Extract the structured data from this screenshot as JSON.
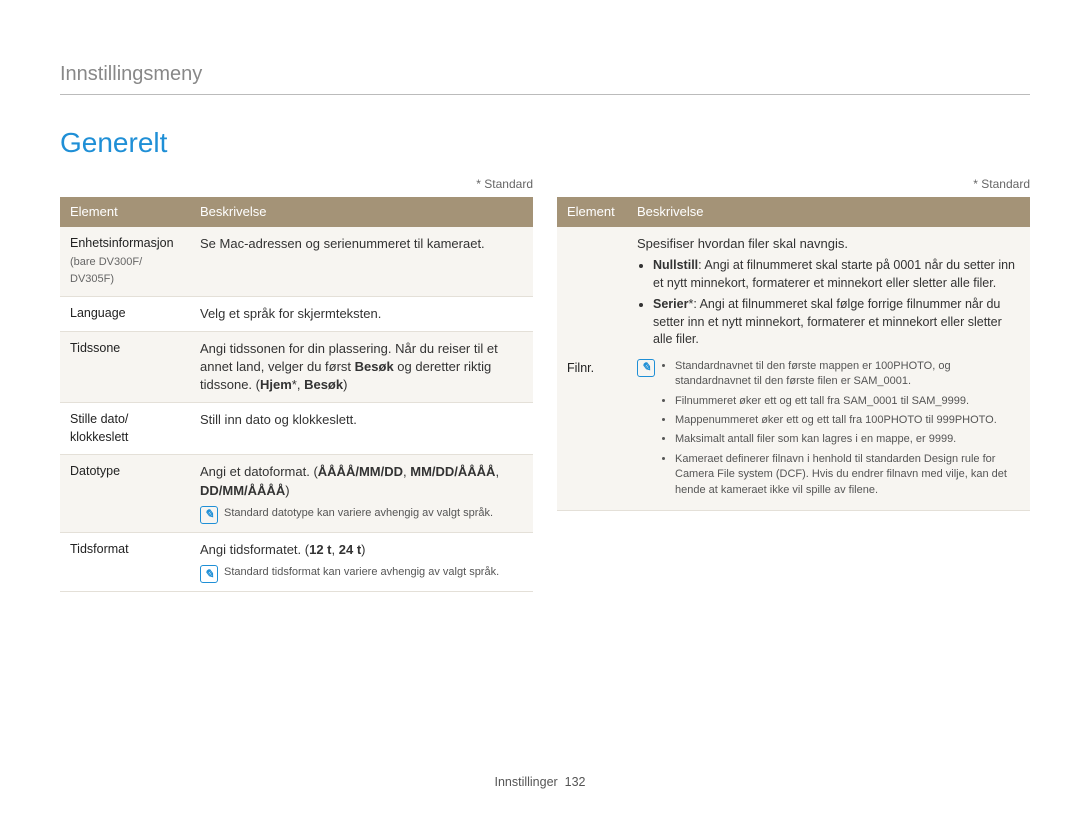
{
  "breadcrumb": "Innstillingsmeny",
  "title": "Generelt",
  "standard_note": "* Standard",
  "headers": {
    "element": "Element",
    "beskrivelse": "Beskrivelse"
  },
  "left": {
    "rows": [
      {
        "label": "Enhetsinformasjon",
        "sub": "(bare DV300F/\nDV305F)",
        "desc": "Se Mac-adressen og serienummeret til kameraet."
      },
      {
        "label": "Language",
        "desc": "Velg et språk for skjermteksten."
      }
    ],
    "tidssone": {
      "label": "Tidssone",
      "pre": "Angi tidssonen for din plassering. Når du reiser til et annet land, velger du først ",
      "b1": "Besøk",
      "mid": " og deretter riktig tidssone. (",
      "b2": "Hjem",
      "sep": "*, ",
      "b3": "Besøk",
      "post": ")"
    },
    "stille": {
      "label": "Stille dato/\nklokkeslett",
      "desc": "Still inn dato og klokkeslett."
    },
    "datotype": {
      "label": "Datotype",
      "pre": "Angi et datoformat. (",
      "b1": "ÅÅÅÅ/MM/DD",
      "c1": ", ",
      "b2": "MM/DD/ÅÅÅÅ",
      "c2": ", ",
      "b3": "DD/MM/ÅÅÅÅ",
      "post": ")",
      "note": "Standard datotype kan variere avhengig av valgt språk."
    },
    "tidsformat": {
      "label": "Tidsformat",
      "pre": "Angi tidsformatet. (",
      "b1": "12 t",
      "c1": ", ",
      "b2": "24 t",
      "post": ")",
      "note": "Standard tidsformat kan variere avhengig av valgt språk."
    }
  },
  "right": {
    "filnr": {
      "label": "Filnr.",
      "intro": "Spesifiser hvordan filer skal navngis.",
      "nullstill": {
        "b": "Nullstill",
        "text": ": Angi at filnummeret skal starte på 0001 når du setter inn et nytt minnekort, formaterer et minnekort eller sletter alle filer."
      },
      "serier": {
        "b": "Serier",
        "text": "*: Angi at filnummeret skal følge forrige filnummer når du setter inn et nytt minnekort, formaterer et minnekort eller sletter alle filer."
      },
      "notes": [
        "Standardnavnet til den første mappen er 100PHOTO, og standardnavnet til den første filen er SAM_0001.",
        "Filnummeret øker ett og ett tall fra SAM_0001 til SAM_9999.",
        "Mappenummeret øker ett og ett tall fra 100PHOTO til 999PHOTO.",
        "Maksimalt antall filer som kan lagres i en mappe, er 9999.",
        "Kameraet definerer filnavn i henhold til standarden Design rule for Camera File system (DCF). Hvis du endrer filnavn med vilje, kan det hende at kameraet ikke vil spille av filene."
      ]
    }
  },
  "footer": {
    "section": "Innstillinger",
    "page": "132"
  }
}
